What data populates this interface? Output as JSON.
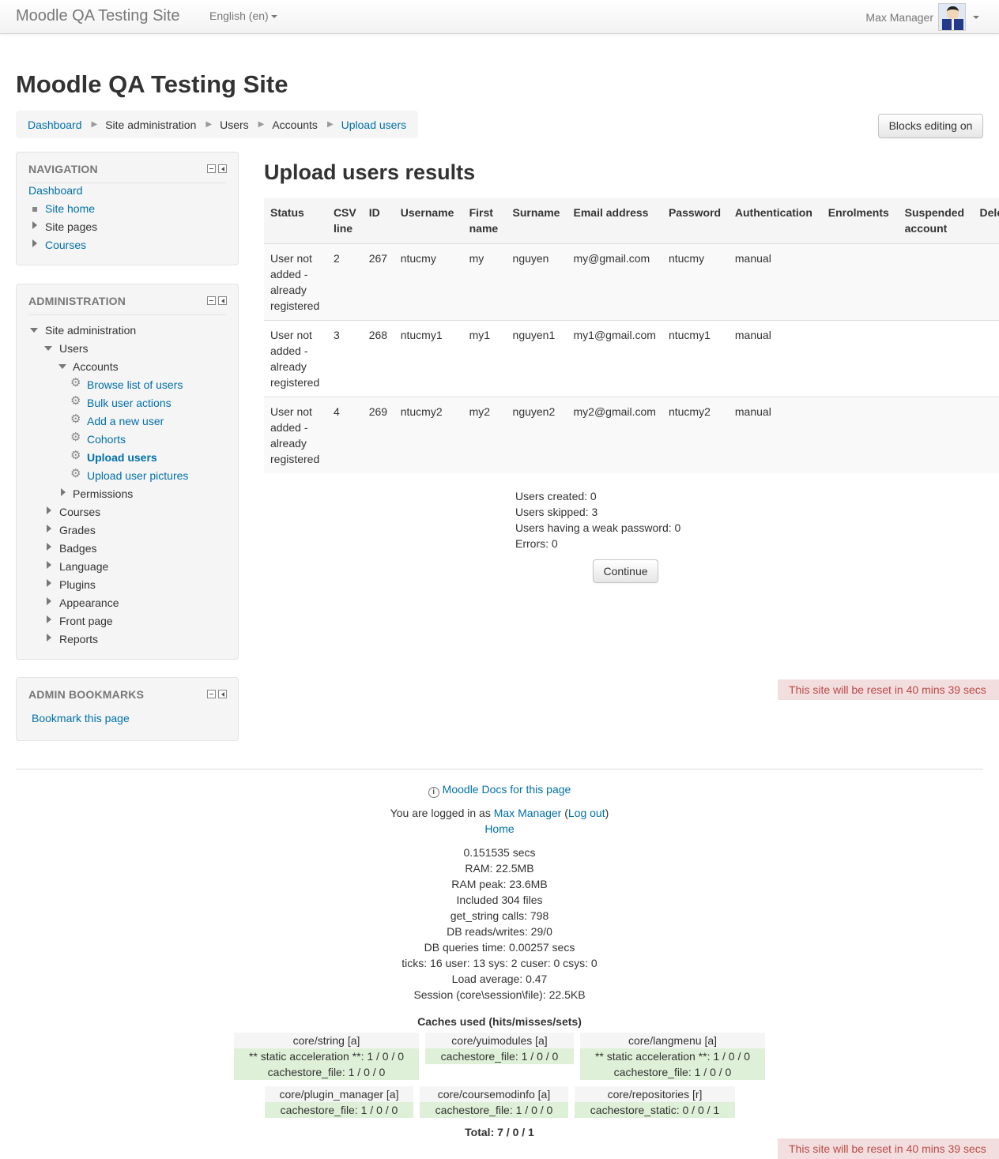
{
  "navbar": {
    "brand": "Moodle QA Testing Site",
    "language": "English (en)",
    "user_name": "Max Manager"
  },
  "header": {
    "site_title": "Moodle QA Testing Site",
    "breadcrumb": [
      "Dashboard",
      "Site administration",
      "Users",
      "Accounts",
      "Upload users"
    ],
    "edit_button": "Blocks editing on"
  },
  "navigation": {
    "title": "NAVIGATION",
    "items": [
      "Dashboard",
      "Site home",
      "Site pages",
      "Courses"
    ]
  },
  "administration": {
    "title": "ADMINISTRATION",
    "site_admin": "Site administration",
    "users": "Users",
    "accounts": "Accounts",
    "account_links": [
      "Browse list of users",
      "Bulk user actions",
      "Add a new user",
      "Cohorts",
      "Upload users",
      "Upload user pictures"
    ],
    "permissions": "Permissions",
    "sections": [
      "Courses",
      "Grades",
      "Badges",
      "Language",
      "Plugins",
      "Appearance",
      "Front page",
      "Reports"
    ]
  },
  "bookmarks": {
    "title": "ADMIN BOOKMARKS",
    "link": "Bookmark this page"
  },
  "main": {
    "heading": "Upload users results",
    "columns": [
      "Status",
      "CSV line",
      "ID",
      "Username",
      "First name",
      "Surname",
      "Email address",
      "Password",
      "Authentication",
      "Enrolments",
      "Suspended account",
      "Dele"
    ],
    "rows": [
      {
        "status": "User not added - already registered",
        "csv": "2",
        "id": "267",
        "username": "ntucmy",
        "first": "my",
        "surname": "nguyen",
        "email": "my@gmail.com",
        "password": "ntucmy",
        "auth": "manual"
      },
      {
        "status": "User not added - already registered",
        "csv": "3",
        "id": "268",
        "username": "ntucmy1",
        "first": "my1",
        "surname": "nguyen1",
        "email": "my1@gmail.com",
        "password": "ntucmy1",
        "auth": "manual"
      },
      {
        "status": "User not added - already registered",
        "csv": "4",
        "id": "269",
        "username": "ntucmy2",
        "first": "my2",
        "surname": "nguyen2",
        "email": "my2@gmail.com",
        "password": "ntucmy2",
        "auth": "manual"
      }
    ],
    "summary": [
      "Users created: 0",
      "Users skipped: 3",
      "Users having a weak password: 0",
      "Errors: 0"
    ],
    "continue": "Continue",
    "reset_notice": "This site will be reset in 40 mins 39 secs"
  },
  "footer": {
    "docs_link": "Moodle Docs for this page",
    "logged_in_prefix": "You are logged in as ",
    "logged_in_user": "Max Manager",
    "paren_open": " (",
    "logout": "Log out",
    "paren_close": ")",
    "home": "Home",
    "perf": [
      "0.151535 secs",
      "RAM: 22.5MB",
      "RAM peak: 23.6MB",
      "Included 304 files",
      "get_string calls: 798",
      "DB reads/writes: 29/0",
      "DB queries time: 0.00257 secs",
      "ticks: 16 user: 13 sys: 2 cuser: 0 csys: 0",
      "Load average: 0.47",
      "Session (core\\session\\file): 22.5KB"
    ],
    "caches_title": "Caches used (hits/misses/sets)",
    "caches": [
      {
        "name": "core/string [a]",
        "lines": [
          "** static acceleration **: 1 / 0 / 0",
          "cachestore_file: 1 / 0 / 0"
        ]
      },
      {
        "name": "core/yuimodules [a]",
        "lines": [
          "cachestore_file: 1 / 0 / 0"
        ]
      },
      {
        "name": "core/langmenu [a]",
        "lines": [
          "** static acceleration **: 1 / 0 / 0",
          "cachestore_file: 1 / 0 / 0"
        ]
      },
      {
        "name": "core/plugin_manager [a]",
        "lines": [
          "cachestore_file: 1 / 0 / 0"
        ]
      },
      {
        "name": "core/coursemodinfo [a]",
        "lines": [
          "cachestore_file: 1 / 0 / 0"
        ]
      },
      {
        "name": "core/repositories [r]",
        "lines": [
          "cachestore_static: 0 / 0 / 1"
        ]
      }
    ],
    "total": "Total: 7 / 0 / 1"
  }
}
